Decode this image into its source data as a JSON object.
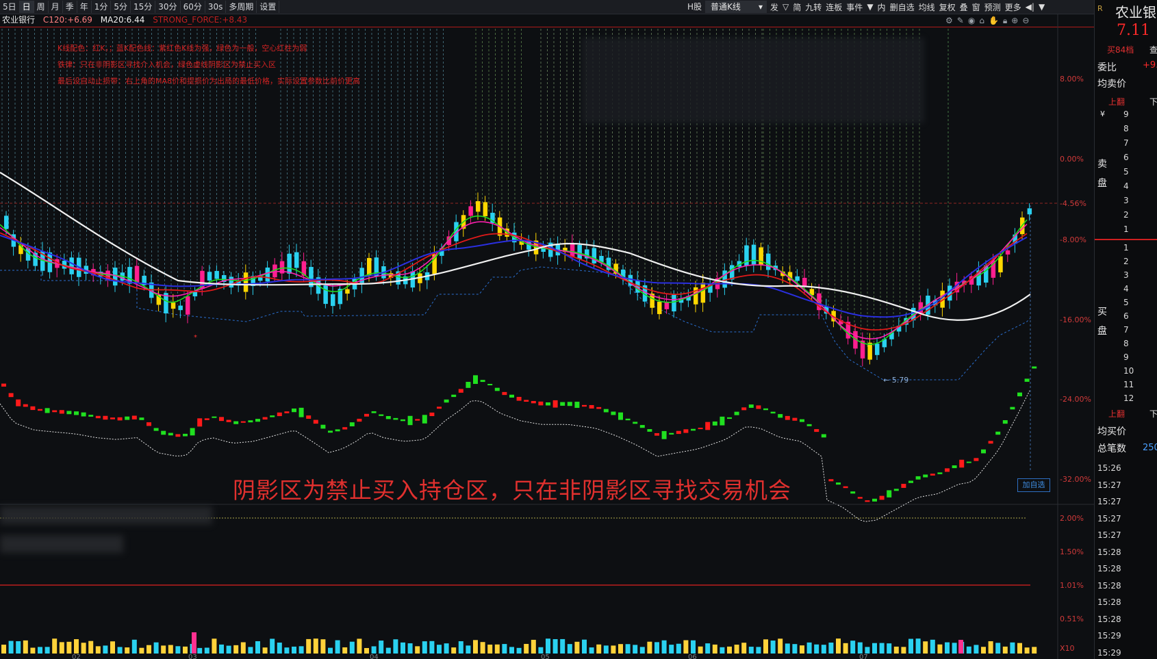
{
  "toolbar": {
    "period_first": "5日",
    "periods": [
      "日",
      "周",
      "月",
      "季",
      "年",
      "1分",
      "5分",
      "15分",
      "30分",
      "60分",
      "30s"
    ],
    "multi_period": "多周期",
    "settings": "设置",
    "market": "H股",
    "kline_type": "普通K线",
    "tools": [
      "发",
      "▽",
      "简",
      "九转",
      "连板",
      "事件",
      "▼",
      "内",
      "删自选",
      "均线",
      "复权",
      "叠",
      "窗",
      "预测",
      "更多",
      "◀|",
      "▼"
    ]
  },
  "info": {
    "stock_name": "农业银行",
    "c120_label": "C120:",
    "c120_value": "+6.69",
    "ma20_label": "MA20:",
    "ma20_value": "6.44",
    "strong_label": "STRONG_FORCE:",
    "strong_value": "+8.43"
  },
  "notes": [
    "K线配色：红K，；蓝K配色线：紫红色K线为强，绿色为一般，空心红柱为弱",
    "铁律：只在非阴影区寻找介入机会，绿色虚线阴影区为禁止买入区",
    "最后设自动止损带：右上角的MA8价和提损价为出局的最低价格，实际设置参数比前价更高"
  ],
  "right_axis": [
    "8.00%",
    "0.00%",
    "-4.56%",
    "-8.00%",
    "-16.00%",
    "-24.00%",
    "-32.00%"
  ],
  "lower_axis": [
    "2.00%",
    "1.50%",
    "1.01%",
    "0.51%",
    "X10"
  ],
  "low_price_label": "← 5.79",
  "banner": "阴影区为禁止买入持仓区，只在非阴影区寻找交易机会",
  "add_favorite": "加自选",
  "x_ticks": [
    "02",
    "03",
    "04",
    "05",
    "06",
    "07"
  ],
  "side": {
    "name": "农业银",
    "price": "7.11",
    "buy84": "买84档",
    "tab2": "查",
    "weibi_label": "委比",
    "weibi_value": "+9.",
    "avg_sell": "均卖价",
    "up_label": "上翻",
    "down_label": "下",
    "sell_label": "卖盘",
    "buy_label": "买盘",
    "yen": "¥",
    "sell_levels": [
      "9",
      "8",
      "7",
      "6",
      "5",
      "4",
      "3",
      "2",
      "1"
    ],
    "buy_levels": [
      "1",
      "2",
      "3",
      "4",
      "5",
      "6",
      "7",
      "8",
      "9",
      "10",
      "11",
      "12"
    ],
    "avg_buy": "均买价",
    "total_trades": "总笔数",
    "total_value": "250",
    "times": [
      "15:26",
      "15:27",
      "15:27",
      "15:27",
      "15:27",
      "15:28",
      "15:28",
      "15:28",
      "15:28",
      "15:28",
      "15:29",
      "15:29"
    ]
  },
  "colors": {
    "up": "#ff1f8f",
    "down": "#2ad1f0",
    "yellow": "#ffd700",
    "ma_white": "#f0f0f0",
    "ma_blue": "#2a2fe0",
    "ma_red": "#e01a1a",
    "ma_magenta": "#ff1fb0",
    "ma_green": "#1fd81f"
  }
}
